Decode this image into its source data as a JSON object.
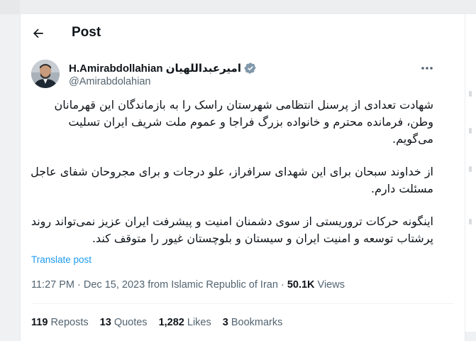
{
  "header": {
    "title": "Post"
  },
  "author": {
    "display_name": "H.Amirabdollahian امیرعبداللهیان",
    "handle": "@Amirabdolahian"
  },
  "post": {
    "paragraphs": [
      "شهادت تعدادی از پرسنل انتظامی شهرستان راسک را به بازماندگان این قهرمانان وطن، فرمانده محترم و خانواده بزرگ فراجا و عموم ملت شریف ایران تسلیت می‌گویم.",
      "از خداوند سبحان برای این شهدای سرافراز، علو درجات و برای مجروحان شفای عاجل مسئلت دارم.",
      "اینگونه حرکات تروریستی از سوی دشمنان امنیت و پیشرفت ایران عزیز نمی‌تواند روند پرشتاب توسعه و امنیت ایران و سیستان و بلوچستان غیور را متوقف کند."
    ],
    "translate_label": "Translate post",
    "time": "11:27 PM",
    "date": "Dec 15, 2023",
    "location_prefix": "from",
    "location": "Islamic Republic of Iran",
    "views_count": "50.1K",
    "views_label": "Views"
  },
  "stats": [
    {
      "count": "119",
      "label": "Reposts"
    },
    {
      "count": "13",
      "label": "Quotes"
    },
    {
      "count": "1,282",
      "label": "Likes"
    },
    {
      "count": "3",
      "label": "Bookmarks"
    }
  ],
  "colors": {
    "accent": "#1d9bf0",
    "verified": "#829aab",
    "muted": "#536471"
  }
}
